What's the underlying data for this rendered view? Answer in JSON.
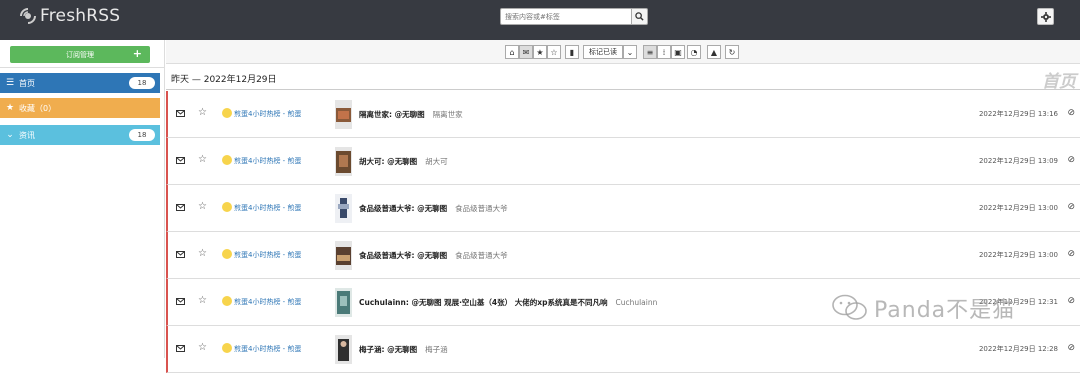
{
  "header": {
    "app_name": "FreshRSS",
    "search_placeholder": "搜索内容或#标签"
  },
  "sidebar": {
    "subscribe_label": "订阅管理",
    "subscribe_plus": "+",
    "items": [
      {
        "label": "首页",
        "count": "18"
      },
      {
        "label": "收藏（0）",
        "count": ""
      },
      {
        "label": "资讯",
        "count": "18"
      }
    ]
  },
  "toolbar": {
    "mark_read_label": "标记已读"
  },
  "content": {
    "day_label": "昨天 — 2022年12月29日",
    "page_title": "首页",
    "entries": [
      {
        "feed": "煎蛋4小时热榜 - 煎蛋",
        "title": "隔离世家: @无聊图",
        "summary": "隔离世家",
        "date": "2022年12月29日 13:16"
      },
      {
        "feed": "煎蛋4小时热榜 - 煎蛋",
        "title": "胡大可: @无聊图",
        "summary": "胡大可",
        "date": "2022年12月29日 13:09"
      },
      {
        "feed": "煎蛋4小时热榜 - 煎蛋",
        "title": "食品级普通大爷: @无聊图",
        "summary": "食品级普通大爷",
        "date": "2022年12月29日 13:00"
      },
      {
        "feed": "煎蛋4小时热榜 - 煎蛋",
        "title": "食品级普通大爷: @无聊图",
        "summary": "食品级普通大爷",
        "date": "2022年12月29日 13:00"
      },
      {
        "feed": "煎蛋4小时热榜 - 煎蛋",
        "title": "Cuchulainn: @无聊图 观展·空山基（4张） 大佬的xp系统真是不同凡响",
        "summary": "Cuchulainn",
        "date": "2022年12月29日 12:31"
      },
      {
        "feed": "煎蛋4小时热榜 - 煎蛋",
        "title": "梅子涵: @无聊图",
        "summary": "梅子涵",
        "date": "2022年12月29日 12:28"
      }
    ]
  },
  "watermark": "Panda不是猫",
  "colors": {
    "header_bg": "#373a41",
    "subscribe_green": "#5cb85c",
    "home_blue": "#2e76b6",
    "fav_orange": "#f0ad4e",
    "news_cyan": "#5bc0de",
    "unread_red": "#d9534f"
  }
}
